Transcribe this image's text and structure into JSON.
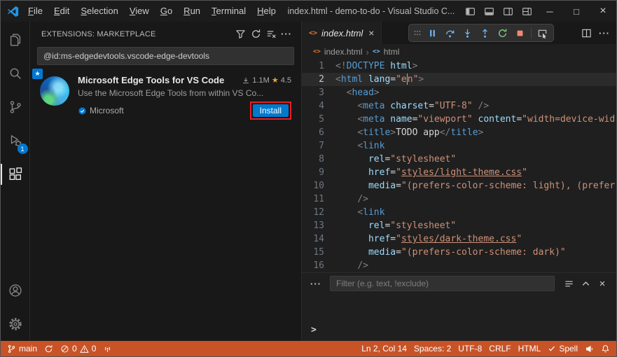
{
  "colors": {
    "accent_blue": "#0078D4",
    "install_button": "#007ACC",
    "status_bar_bg": "#C85327",
    "annotation_red": "#EC1C24",
    "rating_star": "#E8A33D",
    "html_icon_orange": "#E37933"
  },
  "icons": {
    "close": "×",
    "minimize": "─",
    "maximize": "□",
    "star": "★",
    "more": "···",
    "breadcrumb_sep": "›",
    "prompt": ">",
    "code_glyph": "<>"
  },
  "title_bar": {
    "menus": [
      "File",
      "Edit",
      "Selection",
      "View",
      "Go",
      "Run",
      "Terminal",
      "Help"
    ],
    "title": "index.html - demo-to-do - Visual Studio C..."
  },
  "activity_bar": {
    "debug_badge": "1"
  },
  "sidebar": {
    "header": "EXTENSIONS: MARKETPLACE",
    "search_value": "@id:ms-edgedevtools.vscode-edge-devtools",
    "extension": {
      "name": "Microsoft Edge Tools for VS Code",
      "installs": "1.1M",
      "rating": "4.5",
      "description": "Use the Microsoft Edge Tools from within VS Co...",
      "publisher": "Microsoft",
      "install_label": "Install"
    }
  },
  "editor": {
    "tab_label": "index.html",
    "breadcrumb_file": "index.html",
    "breadcrumb_symbol": "html",
    "current_line": 2,
    "code": {
      "lines": [
        {
          "n": 1,
          "tokens": [
            [
              "p",
              "<!"
            ],
            [
              "t",
              "DOCTYPE"
            ],
            [
              "x",
              " "
            ],
            [
              "a",
              "html"
            ],
            [
              "p",
              ">"
            ]
          ]
        },
        {
          "n": 2,
          "tokens": [
            [
              "p",
              "<"
            ],
            [
              "t",
              "html"
            ],
            [
              "x",
              " "
            ],
            [
              "a",
              "lang"
            ],
            [
              "x",
              "="
            ],
            [
              "s",
              "\"e"
            ],
            [
              "c",
              ""
            ],
            [
              "s",
              "n\""
            ],
            [
              "p",
              ">"
            ]
          ]
        },
        {
          "n": 3,
          "tokens": [
            [
              "x",
              "  "
            ],
            [
              "p",
              "<"
            ],
            [
              "t",
              "head"
            ],
            [
              "p",
              ">"
            ]
          ]
        },
        {
          "n": 4,
          "tokens": [
            [
              "x",
              "    "
            ],
            [
              "p",
              "<"
            ],
            [
              "t",
              "meta"
            ],
            [
              "x",
              " "
            ],
            [
              "a",
              "charset"
            ],
            [
              "x",
              "="
            ],
            [
              "s",
              "\"UTF-8\""
            ],
            [
              "x",
              " "
            ],
            [
              "p",
              "/>"
            ]
          ]
        },
        {
          "n": 5,
          "tokens": [
            [
              "x",
              "    "
            ],
            [
              "p",
              "<"
            ],
            [
              "t",
              "meta"
            ],
            [
              "x",
              " "
            ],
            [
              "a",
              "name"
            ],
            [
              "x",
              "="
            ],
            [
              "s",
              "\"viewport\""
            ],
            [
              "x",
              " "
            ],
            [
              "a",
              "content"
            ],
            [
              "x",
              "="
            ],
            [
              "s",
              "\"width=device-wid"
            ]
          ]
        },
        {
          "n": 6,
          "tokens": [
            [
              "x",
              "    "
            ],
            [
              "p",
              "<"
            ],
            [
              "t",
              "title"
            ],
            [
              "p",
              ">"
            ],
            [
              "x",
              "TODO app"
            ],
            [
              "p",
              "</"
            ],
            [
              "t",
              "title"
            ],
            [
              "p",
              ">"
            ]
          ]
        },
        {
          "n": 7,
          "tokens": [
            [
              "x",
              "    "
            ],
            [
              "p",
              "<"
            ],
            [
              "t",
              "link"
            ]
          ]
        },
        {
          "n": 8,
          "tokens": [
            [
              "x",
              "      "
            ],
            [
              "a",
              "rel"
            ],
            [
              "x",
              "="
            ],
            [
              "s",
              "\"stylesheet\""
            ]
          ]
        },
        {
          "n": 9,
          "tokens": [
            [
              "x",
              "      "
            ],
            [
              "a",
              "href"
            ],
            [
              "x",
              "="
            ],
            [
              "s",
              "\""
            ],
            [
              "u",
              "styles/light-theme.css"
            ],
            [
              "s",
              "\""
            ]
          ]
        },
        {
          "n": 10,
          "tokens": [
            [
              "x",
              "      "
            ],
            [
              "a",
              "media"
            ],
            [
              "x",
              "="
            ],
            [
              "s",
              "\"(prefers-color-scheme: light), (prefer"
            ]
          ]
        },
        {
          "n": 11,
          "tokens": [
            [
              "x",
              "    "
            ],
            [
              "p",
              "/>"
            ]
          ]
        },
        {
          "n": 12,
          "tokens": [
            [
              "x",
              "    "
            ],
            [
              "p",
              "<"
            ],
            [
              "t",
              "link"
            ]
          ]
        },
        {
          "n": 13,
          "tokens": [
            [
              "x",
              "      "
            ],
            [
              "a",
              "rel"
            ],
            [
              "x",
              "="
            ],
            [
              "s",
              "\"stylesheet\""
            ]
          ]
        },
        {
          "n": 14,
          "tokens": [
            [
              "x",
              "      "
            ],
            [
              "a",
              "href"
            ],
            [
              "x",
              "="
            ],
            [
              "s",
              "\""
            ],
            [
              "u",
              "styles/dark-theme.css"
            ],
            [
              "s",
              "\""
            ]
          ]
        },
        {
          "n": 15,
          "tokens": [
            [
              "x",
              "      "
            ],
            [
              "a",
              "media"
            ],
            [
              "x",
              "="
            ],
            [
              "s",
              "\"(prefers-color-scheme: dark)\""
            ]
          ]
        },
        {
          "n": 16,
          "tokens": [
            [
              "x",
              "    "
            ],
            [
              "p",
              "/>"
            ]
          ]
        }
      ]
    }
  },
  "panel": {
    "filter_placeholder": "Filter (e.g. text, !exclude)"
  },
  "status_bar": {
    "branch": "main",
    "errors": "0",
    "warnings": "0",
    "line_col": "Ln 2, Col 14",
    "indent": "Spaces: 2",
    "encoding": "UTF-8",
    "eol": "CRLF",
    "language": "HTML",
    "spell": "Spell"
  }
}
